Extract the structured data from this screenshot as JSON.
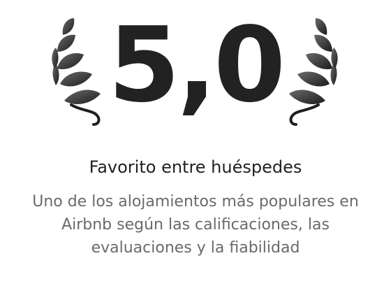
{
  "badge": {
    "rating": "5,0",
    "title": "Favorito entre huéspedes",
    "description": "Uno de los alojamientos más populares en Airbnb según las calificaciones, las evaluaciones y la fiabilidad",
    "laurel_left_icon": "laurel-left-icon",
    "laurel_right_icon": "laurel-right-icon"
  },
  "colors": {
    "text_primary": "#222222",
    "text_secondary": "#6a6a6a",
    "laurel_dark": "#1f1f1f",
    "laurel_light": "#5a5a5a"
  }
}
